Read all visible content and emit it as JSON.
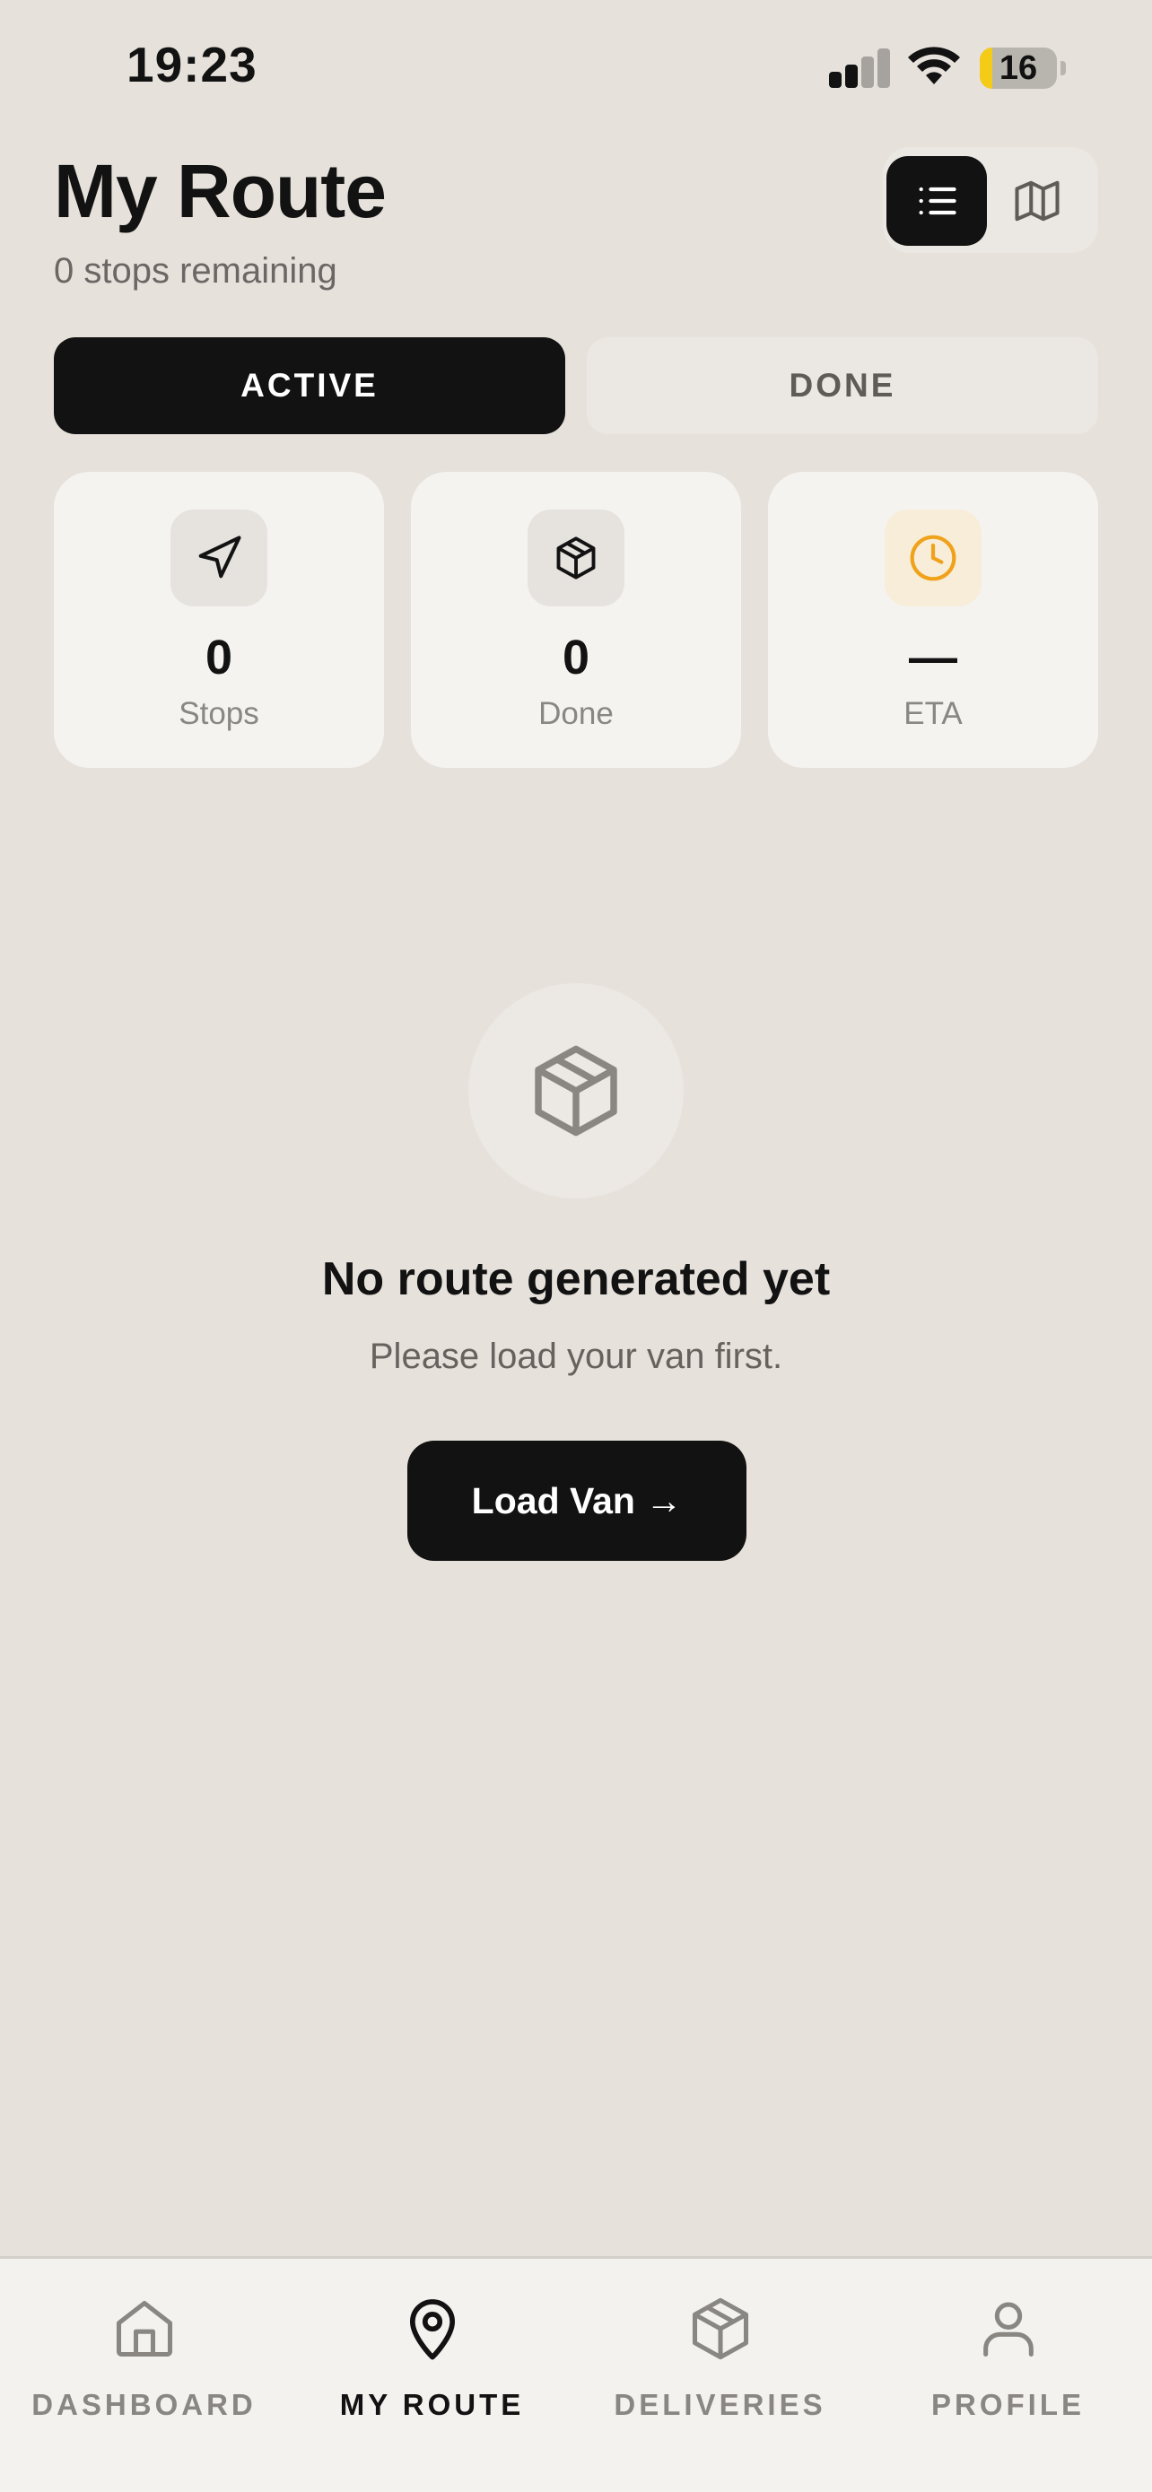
{
  "status_bar": {
    "time": "19:23",
    "battery_percent": 16,
    "battery_label": "16",
    "battery_color": "#f4cc17",
    "signal_bars_active": 2,
    "signal_bars_total": 4
  },
  "header": {
    "title": "My Route",
    "subtitle": "0 stops remaining",
    "view_toggle": [
      {
        "icon": "list-icon",
        "selected": true
      },
      {
        "icon": "map-icon",
        "selected": false
      }
    ]
  },
  "tabs": [
    {
      "label": "ACTIVE",
      "selected": true
    },
    {
      "label": "DONE",
      "selected": false
    }
  ],
  "stats": [
    {
      "icon": "navigation-arrow-icon",
      "value": "0",
      "label": "Stops"
    },
    {
      "icon": "package-icon",
      "value": "0",
      "label": "Done"
    },
    {
      "icon": "clock-icon",
      "value": "—",
      "label": "ETA",
      "accent": "#f0a21b"
    }
  ],
  "empty_state": {
    "icon": "package-icon",
    "title": "No route generated yet",
    "message": "Please load your van first.",
    "button_label": "Load Van →"
  },
  "bottom_nav": [
    {
      "icon": "home-icon",
      "label": "DASHBOARD",
      "active": false
    },
    {
      "icon": "map-pin-icon",
      "label": "MY ROUTE",
      "active": true
    },
    {
      "icon": "package-icon",
      "label": "DELIVERIES",
      "active": false
    },
    {
      "icon": "user-icon",
      "label": "PROFILE",
      "active": false
    }
  ],
  "colors": {
    "background": "#e6e1db",
    "primary": "#121212",
    "card": "#f5f3f0",
    "muted_text": "#8a8782",
    "eta_accent": "#f0a21b"
  }
}
